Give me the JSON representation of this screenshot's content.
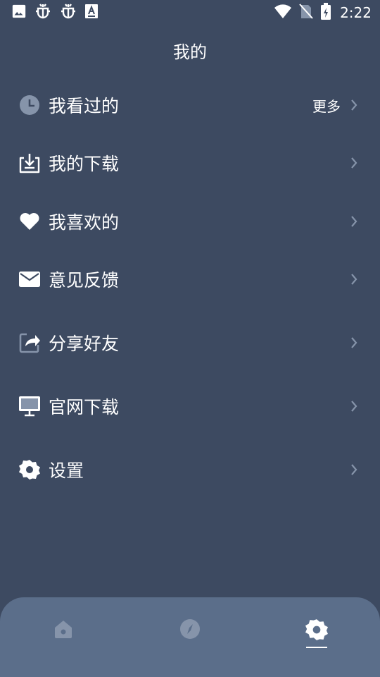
{
  "status_bar": {
    "time": "2:22",
    "icons_left": [
      "image-icon",
      "bug-icon",
      "bug-icon",
      "text-icon"
    ],
    "icons_right": [
      "wifi-icon",
      "no-sim-icon",
      "battery-charging-icon"
    ]
  },
  "page": {
    "title": "我的"
  },
  "menu": {
    "items": [
      {
        "label": "我看过的",
        "more": "更多",
        "icon": "clock-icon"
      },
      {
        "label": "我的下载",
        "icon": "download-icon"
      },
      {
        "label": "我喜欢的",
        "icon": "heart-icon"
      },
      {
        "label": "意见反馈",
        "icon": "mail-icon"
      },
      {
        "label": "分享好友",
        "icon": "share-icon"
      },
      {
        "label": "官网下载",
        "icon": "monitor-icon"
      },
      {
        "label": "设置",
        "icon": "gear-icon"
      }
    ]
  },
  "bottom_nav": {
    "tabs": [
      {
        "icon": "home-icon",
        "active": false
      },
      {
        "icon": "compass-icon",
        "active": false
      },
      {
        "icon": "gear-icon",
        "active": true
      }
    ]
  },
  "colors": {
    "background": "#3d4a61",
    "bottom_nav": "#5b6e8a",
    "icon_muted": "#8694aa",
    "text": "#ffffff"
  }
}
